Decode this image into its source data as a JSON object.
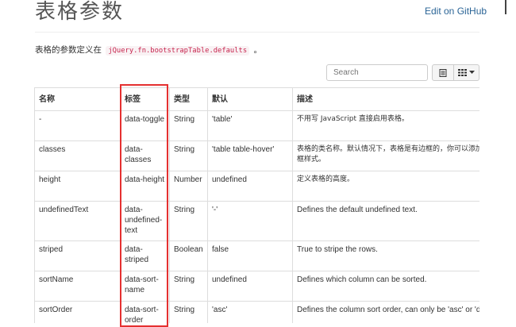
{
  "header": {
    "title": "表格参数",
    "edit_link": "Edit on GitHub"
  },
  "intro": {
    "prefix": "表格的参数定义在",
    "code": "jQuery.fn.bootstrapTable.defaults",
    "suffix": "。"
  },
  "toolbar": {
    "search_placeholder": "Search",
    "list_icon": "list-icon",
    "columns_icon": "columns-grid-icon"
  },
  "table": {
    "columns": [
      "名称",
      "标签",
      "类型",
      "默认",
      "描述"
    ],
    "rows": [
      {
        "name": "-",
        "attr": "data-toggle",
        "type": "String",
        "default": "'table'",
        "desc": "不用写 JavaScript 直接启用表格。"
      },
      {
        "name": "classes",
        "attr": "data-classes",
        "type": "String",
        "default": "'table table-hover'",
        "desc": "表格的类名称。默认情况下，表格是有边框的，你可以添加 来删除表格的边框样式。"
      },
      {
        "name": "height",
        "attr": "data-height",
        "type": "Number",
        "default": "undefined",
        "desc": "定义表格的高度。"
      },
      {
        "name": "undefinedText",
        "attr": "data-undefined-text",
        "type": "String",
        "default": "'-'",
        "desc": "Defines the default undefined text."
      },
      {
        "name": "striped",
        "attr": "data-striped",
        "type": "Boolean",
        "default": "false",
        "desc": "True to stripe the rows."
      },
      {
        "name": "sortName",
        "attr": "data-sort-name",
        "type": "String",
        "default": "undefined",
        "desc": "Defines which column can be sorted."
      },
      {
        "name": "sortOrder",
        "attr": "data-sort-order",
        "type": "String",
        "default": "'asc'",
        "desc": "Defines the column sort order, can only be 'asc' or 'desc'."
      }
    ]
  },
  "colors": {
    "highlight_border": "#e53030",
    "link": "#2a6496",
    "code_text": "#c7254e"
  }
}
